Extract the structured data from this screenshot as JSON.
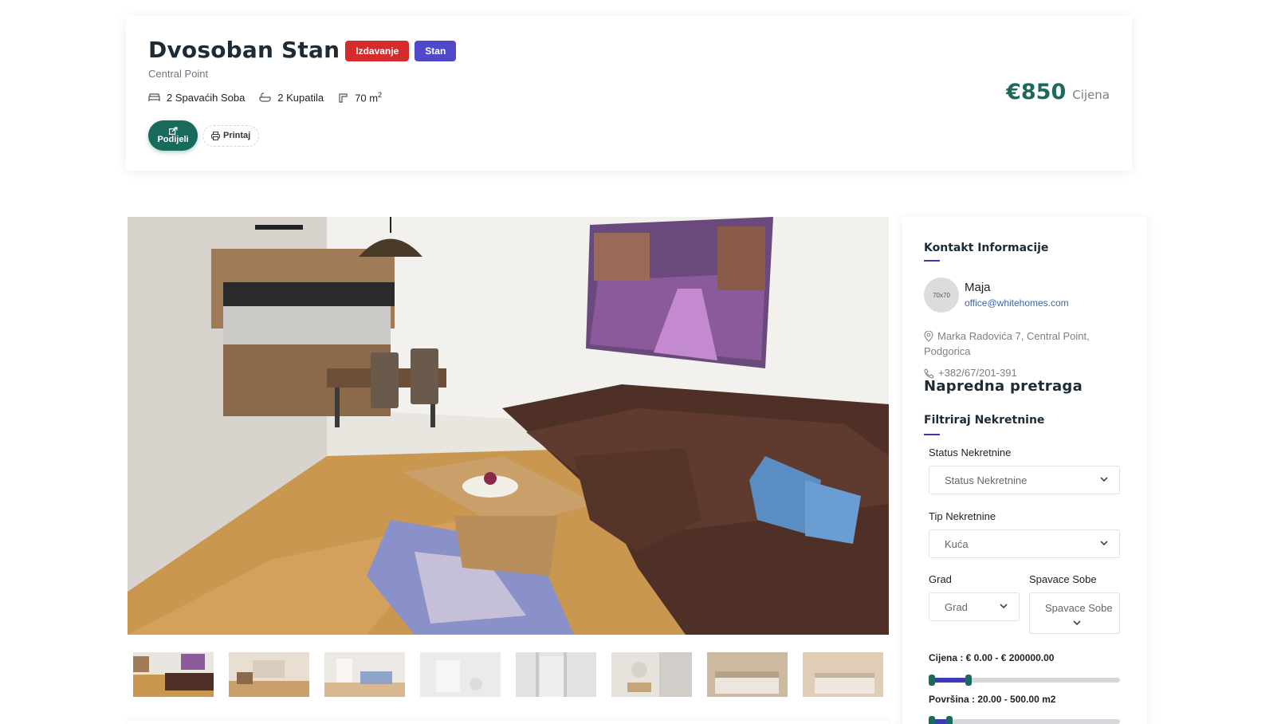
{
  "listing": {
    "title": "Dvosoban Stan",
    "badges": [
      {
        "label": "Izdavanje",
        "color": "#d42c2c"
      },
      {
        "label": "Stan",
        "color": "#5148c8"
      }
    ],
    "location": "Central Point",
    "features": [
      {
        "icon": "bed-icon",
        "label": "2 Spavaćih Soba"
      },
      {
        "icon": "bathtub-icon",
        "label": "2 Kupatila"
      },
      {
        "icon": "area-icon",
        "label": "70 m",
        "sup": "2"
      }
    ],
    "actions": {
      "share": "Podijeli",
      "print": "Printaj"
    },
    "price": "€850",
    "price_label": "Cijena"
  },
  "gallery": {
    "main_photo": "living-room-photo",
    "thumbnail_count": 8
  },
  "contact": {
    "heading": "Kontakt Informacije",
    "avatar_placeholder": "70x70",
    "name": "Maja",
    "email": "office@whitehomes.com",
    "address": "Marka Radovića 7, Central Point, Podgorica",
    "phone": "+382/67/201-391"
  },
  "search": {
    "heading": "Napredna pretraga",
    "subheading": "Filtriraj Nekretnine",
    "status_label": "Status Nekretnine",
    "status_value": "Status Nekretnine",
    "type_label": "Tip Nekretnine",
    "type_value": "Kuća",
    "city_label": "Grad",
    "city_value": "Grad",
    "bedrooms_label": "Spavace Sobe",
    "bedrooms_value": "Spavace Sobe",
    "price_range_label": "Cijena : € 0.00 - € 200000.00",
    "price_range_fill": 0.2,
    "area_range_label": "Površina : 20.00 - 500.00 m2",
    "area_range_fill": 0.1
  },
  "colors": {
    "accent": "#1a6b5d",
    "brand": "#3a35b0"
  }
}
